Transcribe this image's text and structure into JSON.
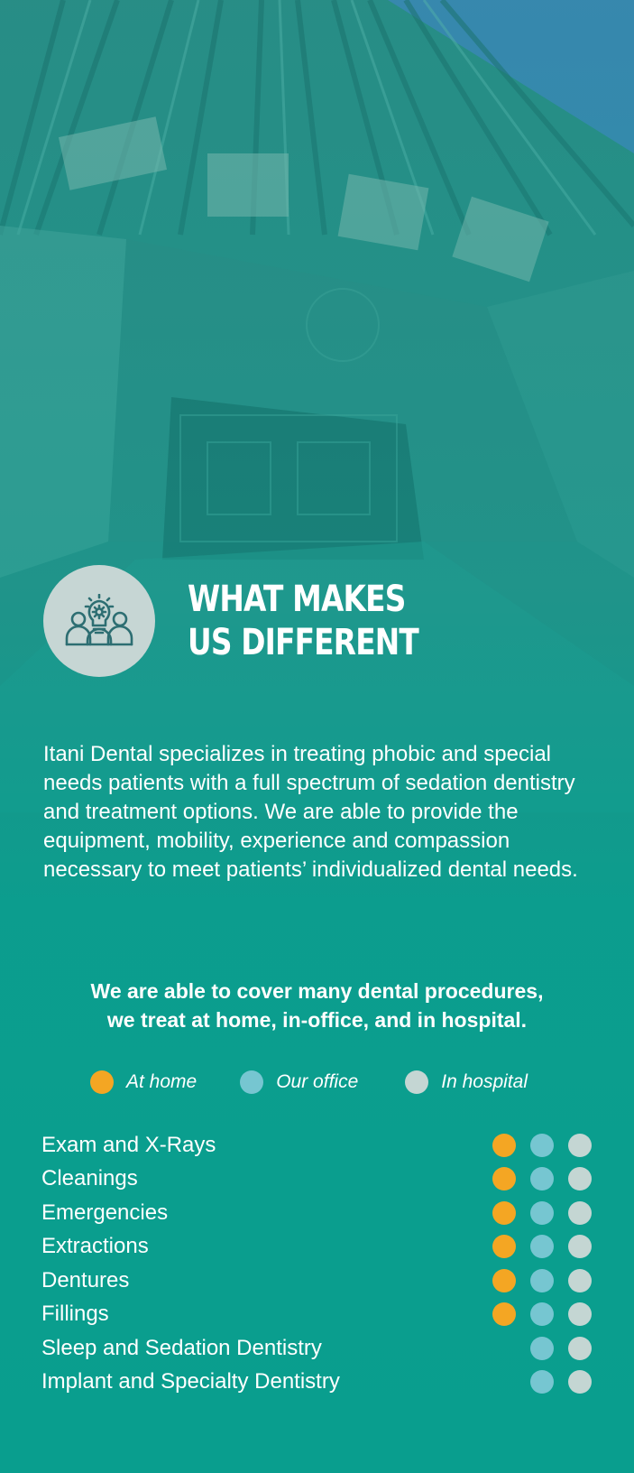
{
  "colors": {
    "at_home": "#f4a623",
    "our_office": "#76c6d1",
    "in_hospital": "#c4d6d3",
    "icon_stroke": "#2d6e72"
  },
  "header": {
    "icon": "team-idea-icon",
    "title_line1": "WHAT MAKES",
    "title_line2": "US DIFFERENT"
  },
  "intro": {
    "text": "Itani Dental specializes in treating phobic and special needs patients with a full spectrum of sedation dentistry and treatment options. We are able to provide the equipment, mobility, experience and compassion necessary to meet patients’ individualized dental needs."
  },
  "subhead": {
    "line1": "We are able to cover many dental procedures,",
    "line2": "we treat at home, in-office, and in hospital."
  },
  "legend": [
    {
      "label": "At home",
      "key": "at_home"
    },
    {
      "label": "Our office",
      "key": "our_office"
    },
    {
      "label": "In hospital",
      "key": "in_hospital"
    }
  ],
  "procedures": [
    {
      "label": "Exam and X-Rays",
      "at_home": true,
      "our_office": true,
      "in_hospital": true
    },
    {
      "label": "Cleanings",
      "at_home": true,
      "our_office": true,
      "in_hospital": true
    },
    {
      "label": "Emergencies",
      "at_home": true,
      "our_office": true,
      "in_hospital": true
    },
    {
      "label": "Extractions",
      "at_home": true,
      "our_office": true,
      "in_hospital": true
    },
    {
      "label": "Dentures",
      "at_home": true,
      "our_office": true,
      "in_hospital": true
    },
    {
      "label": "Fillings",
      "at_home": true,
      "our_office": true,
      "in_hospital": true
    },
    {
      "label": "Sleep and Sedation Dentistry",
      "at_home": false,
      "our_office": true,
      "in_hospital": true
    },
    {
      "label": "Implant and Specialty Dentistry",
      "at_home": false,
      "our_office": true,
      "in_hospital": true
    }
  ]
}
